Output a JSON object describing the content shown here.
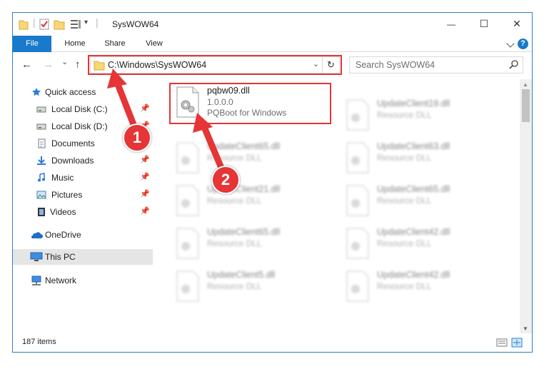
{
  "window": {
    "title": "SysWOW64",
    "controls": {
      "minimize": "—",
      "maximize": "☐",
      "close": "✕"
    }
  },
  "ribbon": {
    "tabs": [
      "File",
      "Home",
      "Share",
      "View"
    ],
    "help_label": "?"
  },
  "address": {
    "path": "C:\\Windows\\SysWOW64",
    "refresh_glyph": "↻",
    "dropdown_glyph": "⌄"
  },
  "search": {
    "placeholder": "Search SysWOW64"
  },
  "nav_buttons": {
    "back": "←",
    "forward": "→",
    "recent": "⌄",
    "up": "↑"
  },
  "sidebar": {
    "items": [
      {
        "label": "Quick access",
        "icon": "star-icon",
        "pinned": false
      },
      {
        "label": "Local Disk (C:)",
        "icon": "drive-icon",
        "pinned": true
      },
      {
        "label": "Local Disk (D:)",
        "icon": "drive-icon",
        "pinned": true
      },
      {
        "label": "Documents",
        "icon": "documents-icon",
        "pinned": true
      },
      {
        "label": "Downloads",
        "icon": "downloads-icon",
        "pinned": true
      },
      {
        "label": "Music",
        "icon": "music-icon",
        "pinned": true
      },
      {
        "label": "Pictures",
        "icon": "pictures-icon",
        "pinned": true
      },
      {
        "label": "Videos",
        "icon": "videos-icon",
        "pinned": true
      },
      {
        "label": "OneDrive",
        "icon": "onedrive-icon",
        "pinned": false
      },
      {
        "label": "This PC",
        "icon": "computer-icon",
        "pinned": false,
        "selected": true
      },
      {
        "label": "Network",
        "icon": "network-icon",
        "pinned": false
      }
    ],
    "pin_glyph": "📌"
  },
  "files": [
    {
      "name": "pqbw09.dll",
      "line2": "1.0.0.0",
      "line3": "PQBoot for Windows",
      "highlighted": true
    },
    {
      "name": "UpdateClient19.dll",
      "line2": "Resource DLL"
    },
    {
      "name": "UpdateClient65.dll",
      "line2": "Resource DLL"
    },
    {
      "name": "UpdateClient63.dll",
      "line2": "Resource DLL"
    },
    {
      "name": "UpdateClient21.dll",
      "line2": "Resource DLL"
    },
    {
      "name": "UpdateClient65.dll",
      "line2": "Resource DLL"
    },
    {
      "name": "UpdateClient65.dll",
      "line2": "Resource DLL"
    },
    {
      "name": "UpdateClient42.dll",
      "line2": "Resource DLL"
    },
    {
      "name": "UpdateClient5.dll",
      "line2": "Resource DLL"
    },
    {
      "name": "UpdateClient42.dll",
      "line2": "Resource DLL"
    }
  ],
  "status": {
    "item_count": "187 items"
  },
  "annotations": {
    "step1": "1",
    "step2": "2"
  },
  "colors": {
    "accent": "#1979ca",
    "highlight_red": "#e53537",
    "window_border": "#2b80c7"
  }
}
